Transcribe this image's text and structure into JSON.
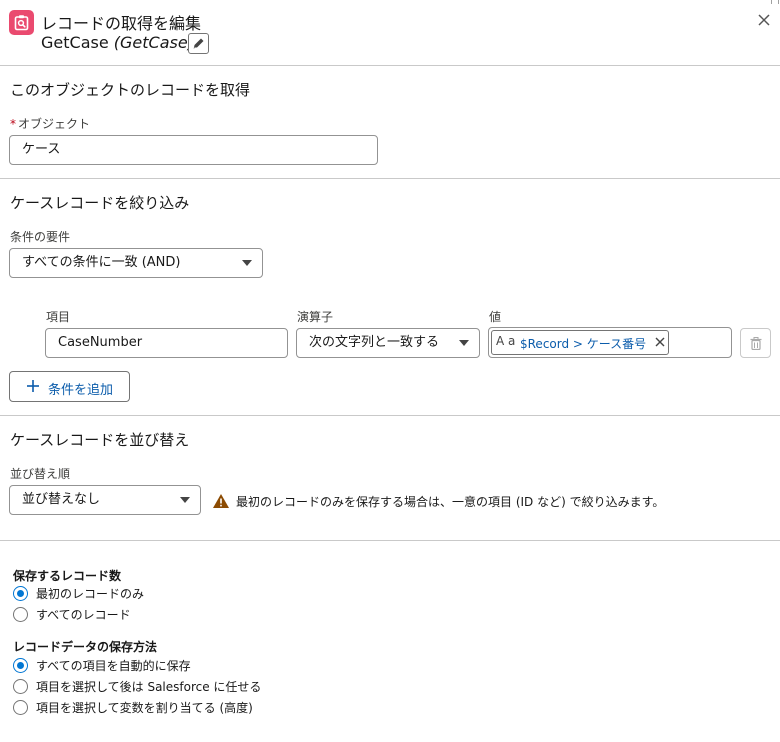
{
  "header": {
    "title": "レコードの取得を編集",
    "api_name": "GetCase",
    "api_name_paren": "(GetCase)",
    "icon": "get-records-icon",
    "accent": "#ea4a6f"
  },
  "object_section": {
    "title": "このオブジェクトのレコードを取得",
    "object_label": "オブジェクト",
    "required_mark": "*",
    "object_value": "ケース"
  },
  "filter_section": {
    "title": "ケースレコードを絞り込み",
    "condition_label": "条件の要件",
    "condition_value": "すべての条件に一致 (AND)",
    "columns": {
      "field": "項目",
      "operator": "演算子",
      "value": "値"
    },
    "rows": [
      {
        "field": "CaseNumber",
        "operator": "次の文字列と一致する",
        "value_pill": "$Record > ケース番号",
        "value_icon": "A a"
      }
    ],
    "add_button": "条件を追加"
  },
  "sort_section": {
    "title": "ケースレコードを並び替え",
    "order_label": "並び替え順",
    "order_value": "並び替えなし",
    "warning": "最初のレコードのみを保存する場合は、一意の項目 (ID など) で絞り込みます。"
  },
  "store_count": {
    "label": "保存するレコード数",
    "options": [
      {
        "label": "最初のレコードのみ",
        "selected": true
      },
      {
        "label": "すべてのレコード",
        "selected": false
      }
    ]
  },
  "store_method": {
    "label": "レコードデータの保存方法",
    "options": [
      {
        "label": "すべての項目を自動的に保存",
        "selected": true
      },
      {
        "label": "項目を選択して後は Salesforce に任せる",
        "selected": false
      },
      {
        "label": "項目を選択して変数を割り当てる (高度)",
        "selected": false
      }
    ]
  },
  "colors": {
    "brand": "#0176d3",
    "link": "#0b5cab",
    "required": "#ba0517",
    "warning": "#8c4b02"
  }
}
